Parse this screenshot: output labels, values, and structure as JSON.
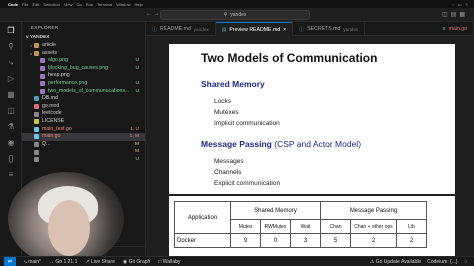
{
  "menubar": {
    "items": [
      "Code",
      "File",
      "Edit",
      "Selection",
      "View",
      "Go",
      "Run",
      "Terminal",
      "Window",
      "Help"
    ]
  },
  "titlebar": {
    "search_text": "yandex",
    "back_arrow": "←",
    "forward_arrow": "→"
  },
  "sidebar": {
    "header": "EXPLORER",
    "root": "YANDEX",
    "items": [
      {
        "label": "article",
        "chev": ">",
        "badge": "",
        "depth": 1,
        "icon": "folder-icon"
      },
      {
        "label": "assets",
        "chev": "v",
        "badge": "",
        "depth": 1,
        "icon": "folder-icon"
      },
      {
        "label": "algo.png",
        "chev": "",
        "badge": "U",
        "depth": 2,
        "icon": "image-file-icon"
      },
      {
        "label": "blocking_bug_causes.png",
        "chev": "",
        "badge": "U",
        "depth": 2,
        "icon": "image-file-icon"
      },
      {
        "label": "heap.png",
        "chev": "",
        "badge": "",
        "depth": 2,
        "icon": "image-file-icon"
      },
      {
        "label": "performance.png",
        "chev": "",
        "badge": "U",
        "depth": 2,
        "icon": "image-file-icon"
      },
      {
        "label": "two_models_of_communucations...",
        "chev": "",
        "badge": "U",
        "depth": 2,
        "icon": "image-file-icon"
      },
      {
        "label": "DB.md",
        "chev": "",
        "badge": "",
        "depth": 1,
        "icon": "info-file-icon"
      },
      {
        "label": "go.mod",
        "chev": "",
        "badge": "",
        "depth": 1,
        "icon": "go-mod-icon"
      },
      {
        "label": "leetcode",
        "chev": "",
        "badge": "",
        "depth": 1,
        "icon": "file-icon"
      },
      {
        "label": "LICENSE",
        "chev": "",
        "badge": "",
        "depth": 1,
        "icon": "license-icon"
      },
      {
        "label": "main_test.go",
        "chev": "",
        "badge": "1, U",
        "depth": 1,
        "icon": "go-file-icon"
      },
      {
        "label": "main.go",
        "chev": "",
        "badge": "1, M",
        "depth": 1,
        "icon": "go-file-icon"
      },
      {
        "label": "Q...",
        "chev": "",
        "badge": "M",
        "depth": 1,
        "icon": "file-icon"
      },
      {
        "label": "",
        "chev": "",
        "badge": "M",
        "depth": 1,
        "icon": "file-icon"
      },
      {
        "label": "",
        "chev": "",
        "badge": "U",
        "depth": 1,
        "icon": "file-icon"
      }
    ]
  },
  "tabs": [
    {
      "label": "README.md",
      "hint": "yandex",
      "active": false
    },
    {
      "label": "Preview README.md",
      "hint": "",
      "active": true
    },
    {
      "label": "SECRETS.md",
      "hint": "yandex",
      "active": false
    },
    {
      "label": "main.go",
      "hint": "",
      "active": false
    }
  ],
  "slide": {
    "title": "Two Models of Communication",
    "section1": {
      "heading": "Shared Memory",
      "items": [
        "Locks",
        "Mutexes",
        "Implicit communication"
      ]
    },
    "section2": {
      "heading": "Message Passing",
      "heading_suffix": "(CSP and Actor Model)",
      "items": [
        "Messages",
        "Channels",
        "Explicit communication"
      ]
    }
  },
  "table": {
    "header_top": [
      "Application",
      "Shared Memory",
      "Message Passing"
    ],
    "header_sub": [
      "Mutex",
      "RWMutex",
      "Wait",
      "Chan",
      "Chan + other ops",
      "Lib"
    ],
    "rows": [
      {
        "app": "Docker",
        "values": [
          "9",
          "0",
          "3",
          "5",
          "2",
          "2"
        ]
      }
    ]
  },
  "statusbar": {
    "branch": "main*",
    "go_version": "Go 1.21.1",
    "live_share": "Live Share",
    "git_graph": "Git Graph",
    "wallaby": "Wallaby",
    "go_update": "Go Update Available",
    "codeium": "Codeium: {...}"
  },
  "colors": {
    "accent": "#0078d4",
    "heading_blue": "#1f2a8a",
    "untracked": "#73c991",
    "modified": "#e2c08d"
  }
}
